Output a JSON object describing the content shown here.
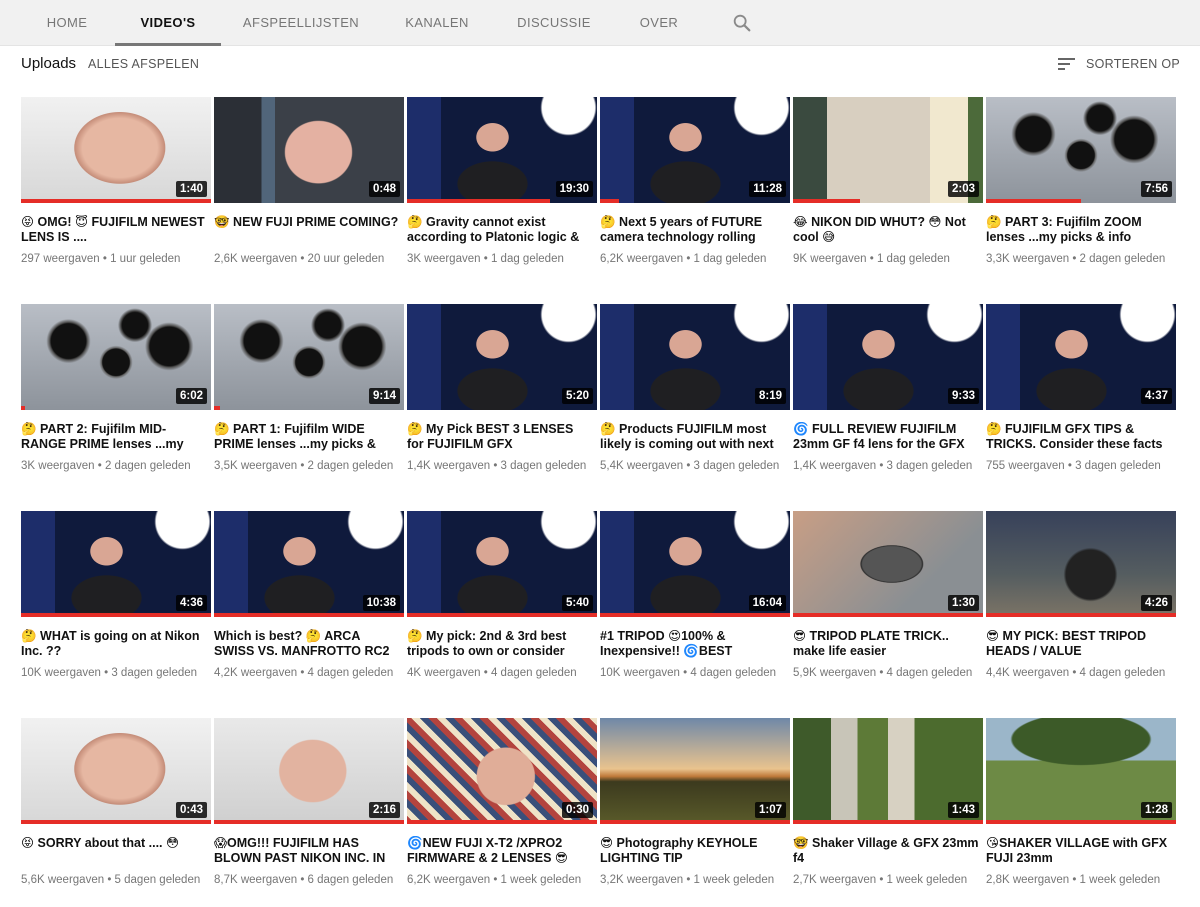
{
  "tabs": [
    {
      "label": "HOME",
      "active": false
    },
    {
      "label": "VIDEO'S",
      "active": true
    },
    {
      "label": "AFSPEELLIJSTEN",
      "active": false
    },
    {
      "label": "KANALEN",
      "active": false
    },
    {
      "label": "DISCUSSIE",
      "active": false
    },
    {
      "label": "OVER",
      "active": false
    }
  ],
  "search_icon": "search-icon",
  "uploads": {
    "title": "Uploads",
    "play_all": "ALLES AFSPELEN",
    "sort_label": "SORTEREN OP",
    "sort_icon": "sort-icon"
  },
  "colors": {
    "progress": "#e52d27",
    "active_tab_underline": "#777777"
  },
  "videos": [
    {
      "title": "😝 OMG! 😇 FUJIFILM NEWEST LENS IS ....",
      "duration": "1:40",
      "views": "297 weergaven",
      "age": "1 uur geleden",
      "watched": 1.0,
      "art": "face"
    },
    {
      "title": "🤓 NEW FUJI PRIME COMING?",
      "duration": "0:48",
      "views": "2,6K weergaven",
      "age": "20 uur geleden",
      "watched": 0.0,
      "art": "car"
    },
    {
      "title": "🤔 Gravity cannot exist according to Platonic logic &",
      "duration": "19:30",
      "views": "3K weergaven",
      "age": "1 dag geleden",
      "watched": 0.75,
      "art": "studio"
    },
    {
      "title": "🤔 Next 5 years of FUTURE camera technology rolling",
      "duration": "11:28",
      "views": "6,2K weergaven",
      "age": "1 dag geleden",
      "watched": 0.1,
      "art": "studio"
    },
    {
      "title": "😂 NIKON DID WHUT? 😳 Not cool 😅",
      "duration": "2:03",
      "views": "9K weergaven",
      "age": "1 dag geleden",
      "watched": 0.35,
      "art": "laptop"
    },
    {
      "title": "🤔 PART 3: Fujifilm ZOOM lenses ...my picks & info",
      "duration": "7:56",
      "views": "3,3K weergaven",
      "age": "2 dagen geleden",
      "watched": 0.5,
      "art": "lenses"
    },
    {
      "title": "🤔 PART 2: Fujifilm MID-RANGE PRIME lenses ...my",
      "duration": "6:02",
      "views": "3K weergaven",
      "age": "2 dagen geleden",
      "watched": 0.02,
      "art": "lenses"
    },
    {
      "title": "🤔 PART 1: Fujifilm WIDE PRIME lenses ...my picks &",
      "duration": "9:14",
      "views": "3,5K weergaven",
      "age": "2 dagen geleden",
      "watched": 0.03,
      "art": "lenses"
    },
    {
      "title": "🤔 My Pick BEST 3 LENSES for FUJIFILM GFX",
      "duration": "5:20",
      "views": "1,4K weergaven",
      "age": "3 dagen geleden",
      "watched": 0.0,
      "art": "studio"
    },
    {
      "title": "🤔 Products FUJIFILM most likely is coming out with next",
      "duration": "8:19",
      "views": "5,4K weergaven",
      "age": "3 dagen geleden",
      "watched": 0.0,
      "art": "studio"
    },
    {
      "title": "🌀 FULL REVIEW FUJIFILM 23mm GF f4 lens for the GFX",
      "duration": "9:33",
      "views": "1,4K weergaven",
      "age": "3 dagen geleden",
      "watched": 0.0,
      "art": "studio"
    },
    {
      "title": "🤔 FUJIFILM GFX TIPS & TRICKS. Consider these facts",
      "duration": "4:37",
      "views": "755 weergaven",
      "age": "3 dagen geleden",
      "watched": 0.0,
      "art": "studio"
    },
    {
      "title": "🤔 WHAT is going on at Nikon Inc. ??",
      "duration": "4:36",
      "views": "10K weergaven",
      "age": "3 dagen geleden",
      "watched": 1.0,
      "art": "studio"
    },
    {
      "title": "Which is best? 🤔 ARCA SWISS VS. MANFROTTO RC2",
      "duration": "10:38",
      "views": "4,2K weergaven",
      "age": "4 dagen geleden",
      "watched": 1.0,
      "art": "studio"
    },
    {
      "title": "🤔 My pick: 2nd & 3rd best tripods to own or consider",
      "duration": "5:40",
      "views": "4K weergaven",
      "age": "4 dagen geleden",
      "watched": 1.0,
      "art": "studio"
    },
    {
      "title": "#1 TRIPOD 😍100% & Inexpensive!! 🌀BEST",
      "duration": "16:04",
      "views": "10K weergaven",
      "age": "4 dagen geleden",
      "watched": 1.0,
      "art": "studio"
    },
    {
      "title": "😎 TRIPOD PLATE TRICK.. make life easier",
      "duration": "1:30",
      "views": "5,9K weergaven",
      "age": "4 dagen geleden",
      "watched": 1.0,
      "art": "plate"
    },
    {
      "title": "😎 MY PICK: BEST TRIPOD HEADS / VALUE",
      "duration": "4:26",
      "views": "4,4K weergaven",
      "age": "4 dagen geleden",
      "watched": 1.0,
      "art": "tripod"
    },
    {
      "title": "😝 SORRY about that .... 😳",
      "duration": "0:43",
      "views": "5,6K weergaven",
      "age": "5 dagen geleden",
      "watched": 1.0,
      "art": "face"
    },
    {
      "title": "😱OMG!!! FUJIFILM HAS BLOWN PAST NIKON INC. IN",
      "duration": "2:16",
      "views": "8,7K weergaven",
      "age": "6 dagen geleden",
      "watched": 1.0,
      "art": "hand"
    },
    {
      "title": "🌀NEW FUJI X-T2 /XPRO2 FIRMWARE & 2 LENSES 😎",
      "duration": "0:30",
      "views": "6,2K weergaven",
      "age": "1 week geleden",
      "watched": 1.0,
      "art": "quilt"
    },
    {
      "title": "😎 Photography KEYHOLE LIGHTING TIP",
      "duration": "1:07",
      "views": "3,2K weergaven",
      "age": "1 week geleden",
      "watched": 1.0,
      "art": "sunset"
    },
    {
      "title": "🤓 Shaker Village & GFX 23mm f4",
      "duration": "1:43",
      "views": "2,7K weergaven",
      "age": "1 week geleden",
      "watched": 1.0,
      "art": "road"
    },
    {
      "title": "😘SHAKER VILLAGE with GFX FUJI 23mm",
      "duration": "1:28",
      "views": "2,8K weergaven",
      "age": "1 week geleden",
      "watched": 1.0,
      "art": "tree"
    }
  ]
}
